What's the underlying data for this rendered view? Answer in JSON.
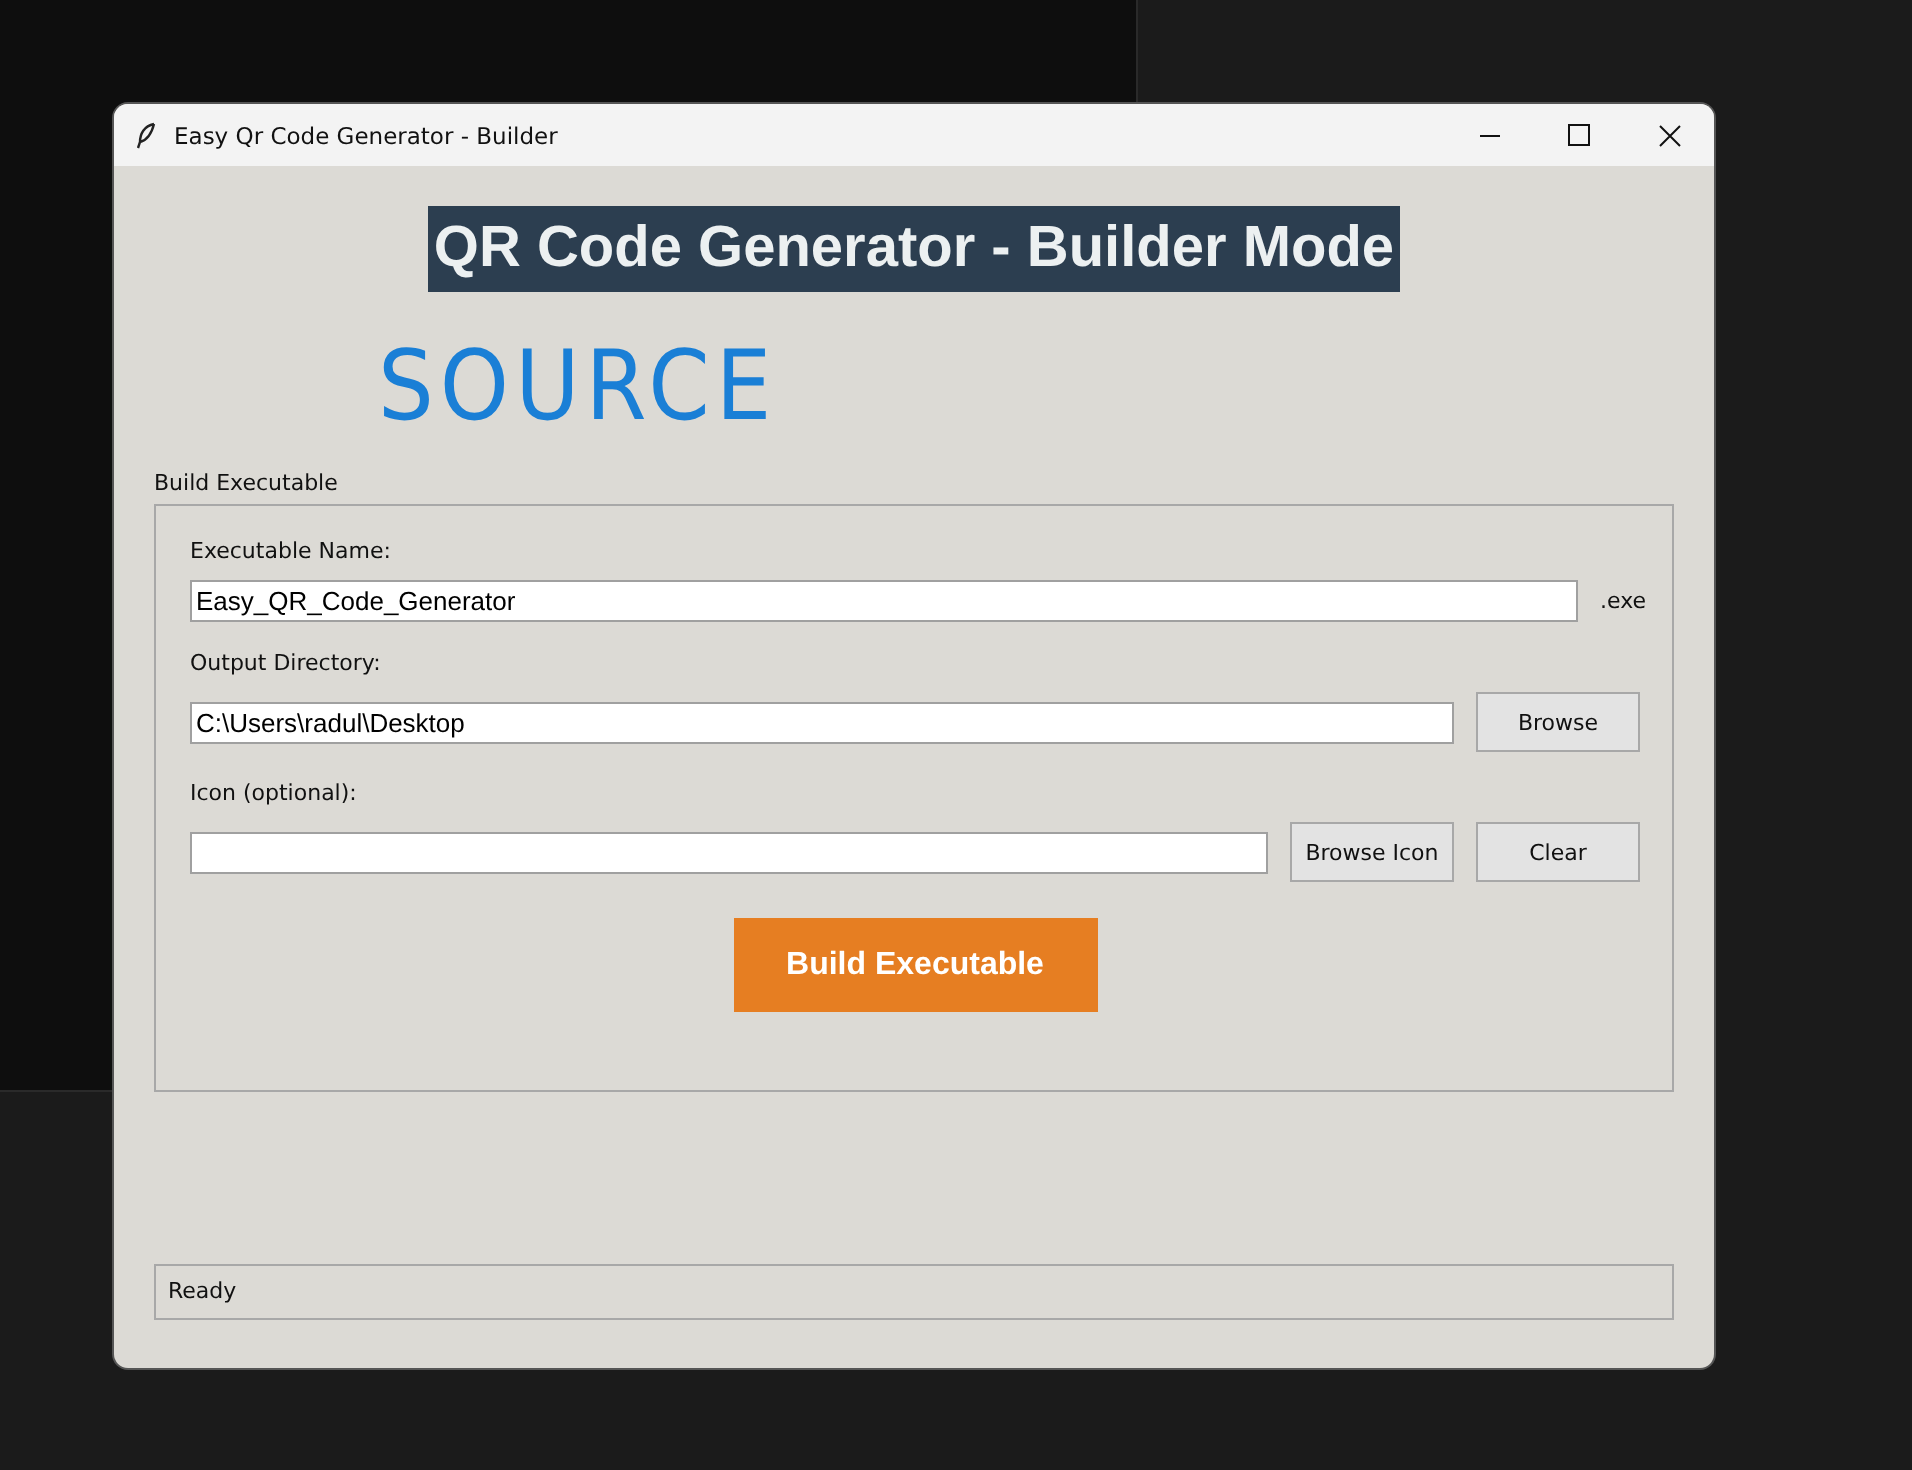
{
  "window": {
    "title": "Easy Qr Code Generator - Builder"
  },
  "heading": "QR Code Generator - Builder Mode",
  "annotation": "SOURCE",
  "group": {
    "title": "Build Executable",
    "fields": [
      {
        "label": "Executable Name:",
        "value": "Easy_QR_Code_Generator",
        "suffix": ".exe"
      },
      {
        "label": "Output Directory:",
        "value": "C:\\Users\\radul\\Desktop",
        "buttons": [
          "Browse"
        ]
      },
      {
        "label": "Icon (optional):",
        "buttons": [
          "Browse Icon",
          "Clear"
        ]
      }
    ],
    "action": "Build Executable"
  },
  "status_bar": "Ready"
}
